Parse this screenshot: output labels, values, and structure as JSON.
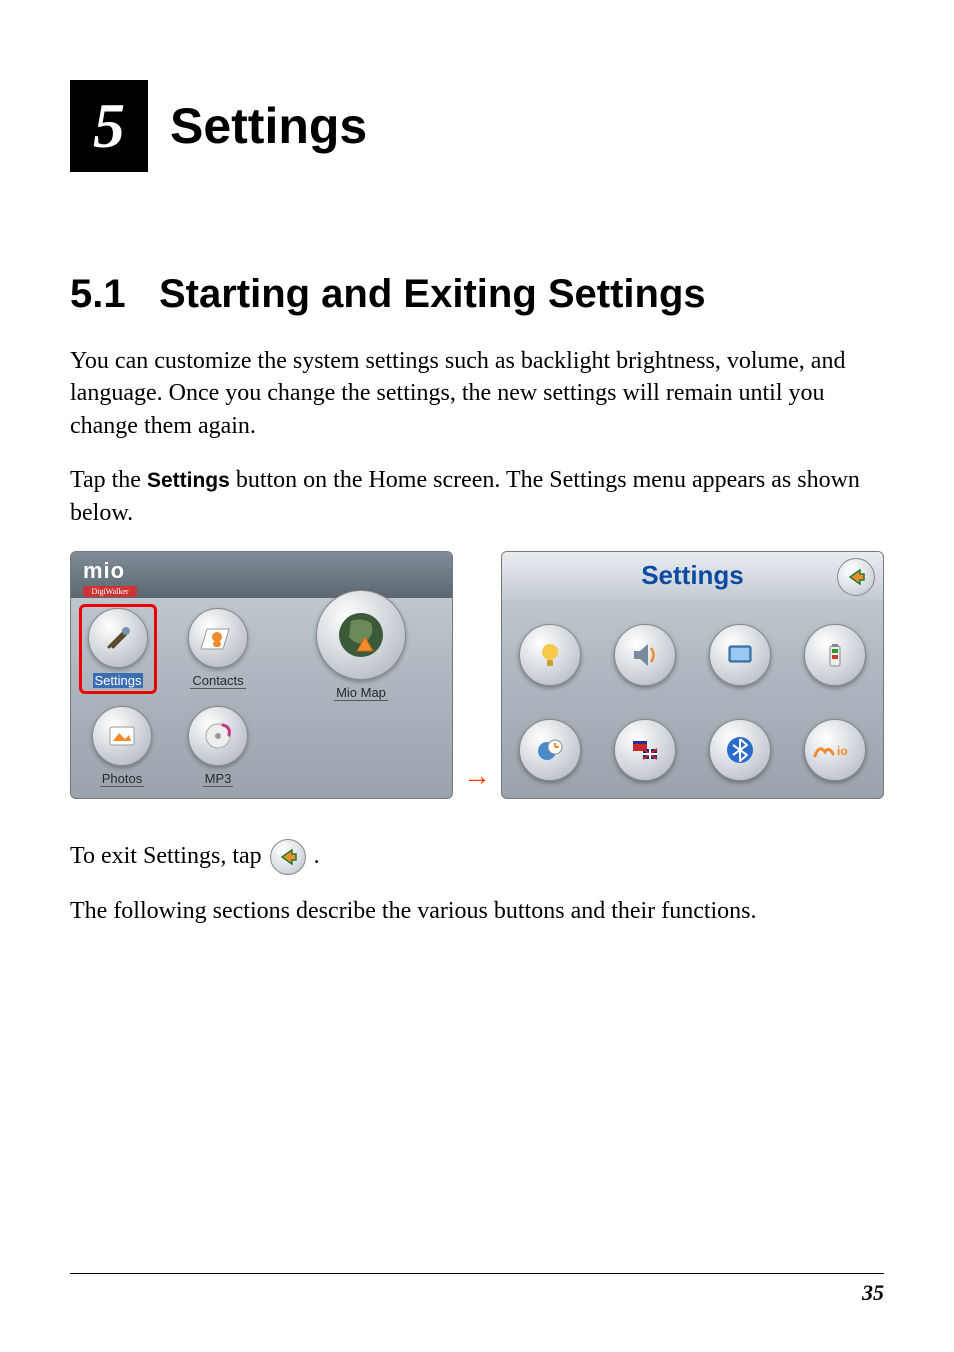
{
  "chapter": {
    "number": "5",
    "title": "Settings"
  },
  "section": {
    "number": "5.1",
    "title": "Starting and Exiting Settings"
  },
  "para1": "You can customize the system settings such as backlight brightness, volume, and language. Once you change the settings, the new settings will remain until you change them again.",
  "para2_a": "Tap the ",
  "para2_bold": "Settings",
  "para2_b": " button on the Home screen. The Settings menu appears as shown below.",
  "exit_a": "To exit Settings, tap",
  "exit_b": ".",
  "para3": "The following sections describe the various buttons and their functions.",
  "home_screen": {
    "logo_name": "mio",
    "logo_tag": "DigiWalker",
    "icons": {
      "settings": "Settings",
      "contacts": "Contacts",
      "miomap": "Mio Map",
      "photos": "Photos",
      "mp3": "MP3"
    }
  },
  "settings_screen": {
    "title": "Settings",
    "icons": [
      "backlight",
      "volume",
      "screen",
      "power",
      "datetime",
      "language",
      "bluetooth",
      "mio"
    ]
  },
  "arrow": "→",
  "page_number": "35"
}
